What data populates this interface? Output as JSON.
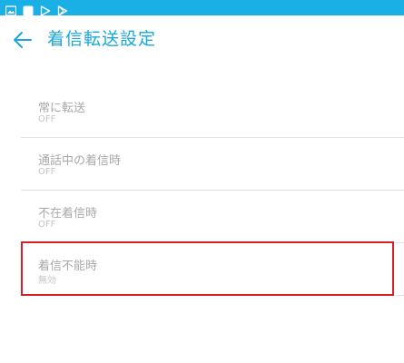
{
  "status_bar": {
    "icons": [
      "image-icon",
      "square-app-icon",
      "play-store-icon",
      "play-store-icon"
    ],
    "background": "#1ab0e6"
  },
  "app_bar": {
    "back_icon": "arrow-left-icon",
    "title": "着信転送設定",
    "title_color": "#1aa7dc"
  },
  "settings": {
    "items": [
      {
        "title": "常に転送",
        "summary": "OFF"
      },
      {
        "title": "通話中の着信時",
        "summary": "OFF"
      },
      {
        "title": "不在着信時",
        "summary": "OFF"
      },
      {
        "title": "着信不能時",
        "summary": "無効"
      }
    ]
  },
  "annotation": {
    "highlight_color": "#d5202a"
  }
}
